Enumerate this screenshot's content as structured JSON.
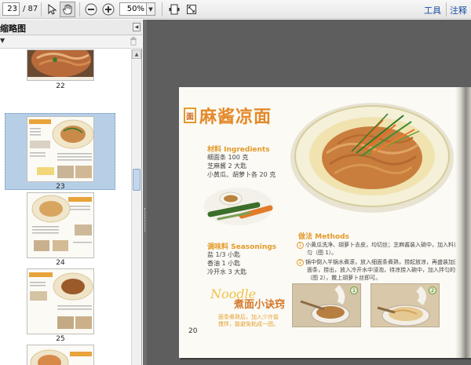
{
  "toolbar": {
    "page_current": "23",
    "page_total": "/ 87",
    "zoom_value": "50%",
    "zoom_dropdown_arrow": "▼",
    "tools_label": "工具",
    "comment_label": "注释"
  },
  "sidebar": {
    "title": "缩略图",
    "close_glyph": "◀",
    "options_glyph": "▼",
    "scroll_up_glyph": "▲",
    "thumbnails": [
      {
        "label": "22",
        "selected": false
      },
      {
        "label": "23",
        "selected": true
      },
      {
        "label": "24",
        "selected": false
      },
      {
        "label": "25",
        "selected": false
      }
    ]
  },
  "document": {
    "dish_badge": "面",
    "dish_title": "麻酱凉面",
    "ingredients_head": "材料 Ingredients",
    "ingredients": [
      "细面条 100 克",
      "芝麻酱 2 大匙",
      "小黄瓜、胡萝卜各 20 克"
    ],
    "seasoning_head": "调味料 Seasonings",
    "seasonings": [
      "盐 1/3 小匙",
      "香油 1 小匙",
      "冷开水 3 大匙"
    ],
    "method_head": "做法 Methods",
    "method_steps": [
      {
        "num": "1",
        "lines": [
          "小黄瓜洗净、胡萝卜去皮，均切丝；芝麻酱装入碗中，加入料调味拌",
          "匀（图 1）。"
        ]
      },
      {
        "num": "2",
        "lines": [
          "锅中倒入半锅水煮滚，放入细面条煮熟，捞起放凉，再盛装加面条",
          "面条，捞出，放入冷开水中浸泡，待凉捞入碗中，加入拌匀的酱汁",
          "（图 2），撒上胡萝卜丝即可。"
        ]
      }
    ],
    "noodle_word": "Noodle",
    "noodle_cn": "煮面小诀窍",
    "tips": [
      "面条煮熟后，加入少许盐",
      "搅拌，能避免粘成一团。"
    ],
    "page_number": "20",
    "photo_step_1": "1",
    "photo_step_2": "2"
  },
  "colors": {
    "accent_orange": "#e4892a",
    "viewer_bg": "#5e5e5e",
    "selection_blue": "#b7cfe6",
    "link_blue": "#1a4fa0"
  }
}
